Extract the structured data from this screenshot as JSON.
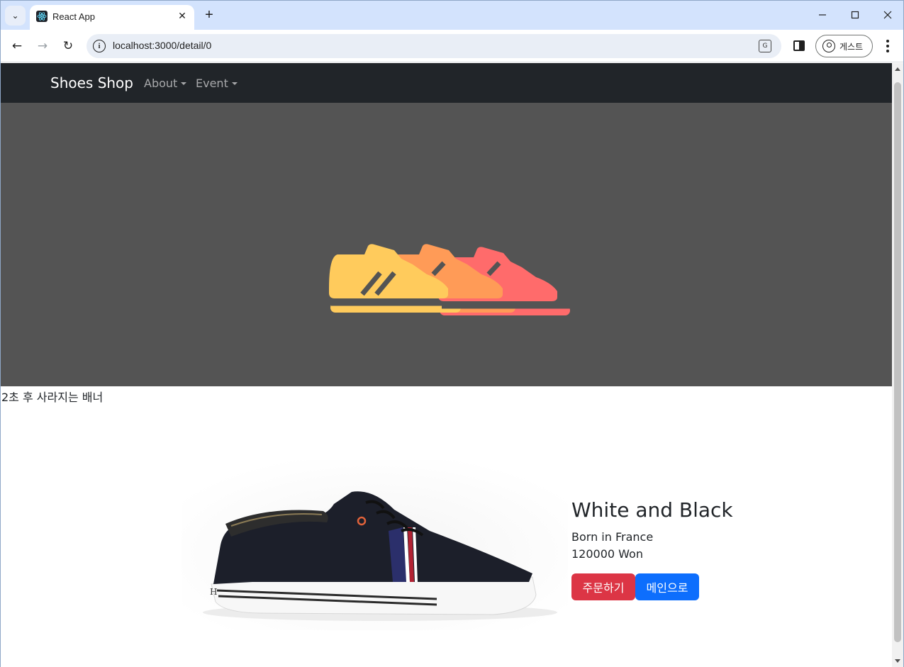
{
  "browser": {
    "tab_title": "React App",
    "url": "localhost:3000/detail/0",
    "profile_label": "게스트",
    "icons": [
      "tab-search-icon",
      "react-favicon-icon",
      "close-icon",
      "plus-icon",
      "minimize-icon",
      "maximize-icon",
      "close-window-icon",
      "back-icon",
      "forward-icon",
      "reload-icon",
      "site-info-icon",
      "translate-icon",
      "side-panel-icon",
      "profile-icon",
      "kebab-menu-icon"
    ]
  },
  "navbar": {
    "brand": "Shoes Shop",
    "links": [
      {
        "label": "About"
      },
      {
        "label": "Event"
      }
    ],
    "bg_color": "#212529"
  },
  "hero": {
    "bg_color": "#545454",
    "shoe_colors": [
      "#ffcb5c",
      "#ff9b57",
      "#ff6b6b"
    ]
  },
  "banner": {
    "text": "2초 후 사라지는 배너"
  },
  "product": {
    "title": "White and Black",
    "origin": "Born in France",
    "price": "120000 Won",
    "order_label": "주문하기",
    "main_label": "메인으로",
    "order_color": "#dc3545",
    "main_color": "#0d6efd"
  }
}
